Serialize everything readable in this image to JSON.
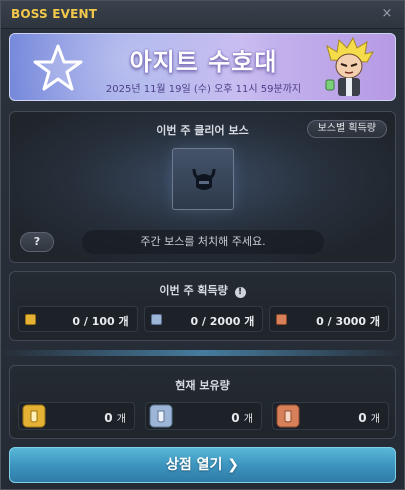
{
  "window": {
    "title": "BOSS EVENT",
    "close_glyph": "×"
  },
  "banner": {
    "title": "아지트 수호대",
    "date": "2025년 11월 19일 (수) 오후 11시 59분까지",
    "icons": [
      "star-icon",
      "character-icon"
    ]
  },
  "boss_panel": {
    "heading": "이번 주 클리어 보스",
    "acquisition_button": "보스별 획득량",
    "help_label": "?",
    "message": "주간 보스를 처치해 주세요."
  },
  "acquisition": {
    "heading": "이번 주 획득량",
    "info_glyph": "!",
    "items": [
      {
        "text": "0 / 100 개",
        "icon": "gold-coin-icon",
        "color": "#e5b235"
      },
      {
        "text": "0 / 2000 개",
        "icon": "silver-coin-icon",
        "color": "#9db6d8"
      },
      {
        "text": "0 / 3000 개",
        "icon": "bronze-coin-icon",
        "color": "#d8805a"
      }
    ]
  },
  "holdings": {
    "heading": "현재 보유량",
    "items": [
      {
        "value": "0",
        "unit": "개",
        "icon": "gold-coin-icon",
        "color": "#e5b235"
      },
      {
        "value": "0",
        "unit": "개",
        "icon": "silver-coin-icon",
        "color": "#9db6d8"
      },
      {
        "value": "0",
        "unit": "개",
        "icon": "bronze-coin-icon",
        "color": "#d8805a"
      }
    ]
  },
  "shop_button": {
    "label": "상점 열기 ❯"
  }
}
